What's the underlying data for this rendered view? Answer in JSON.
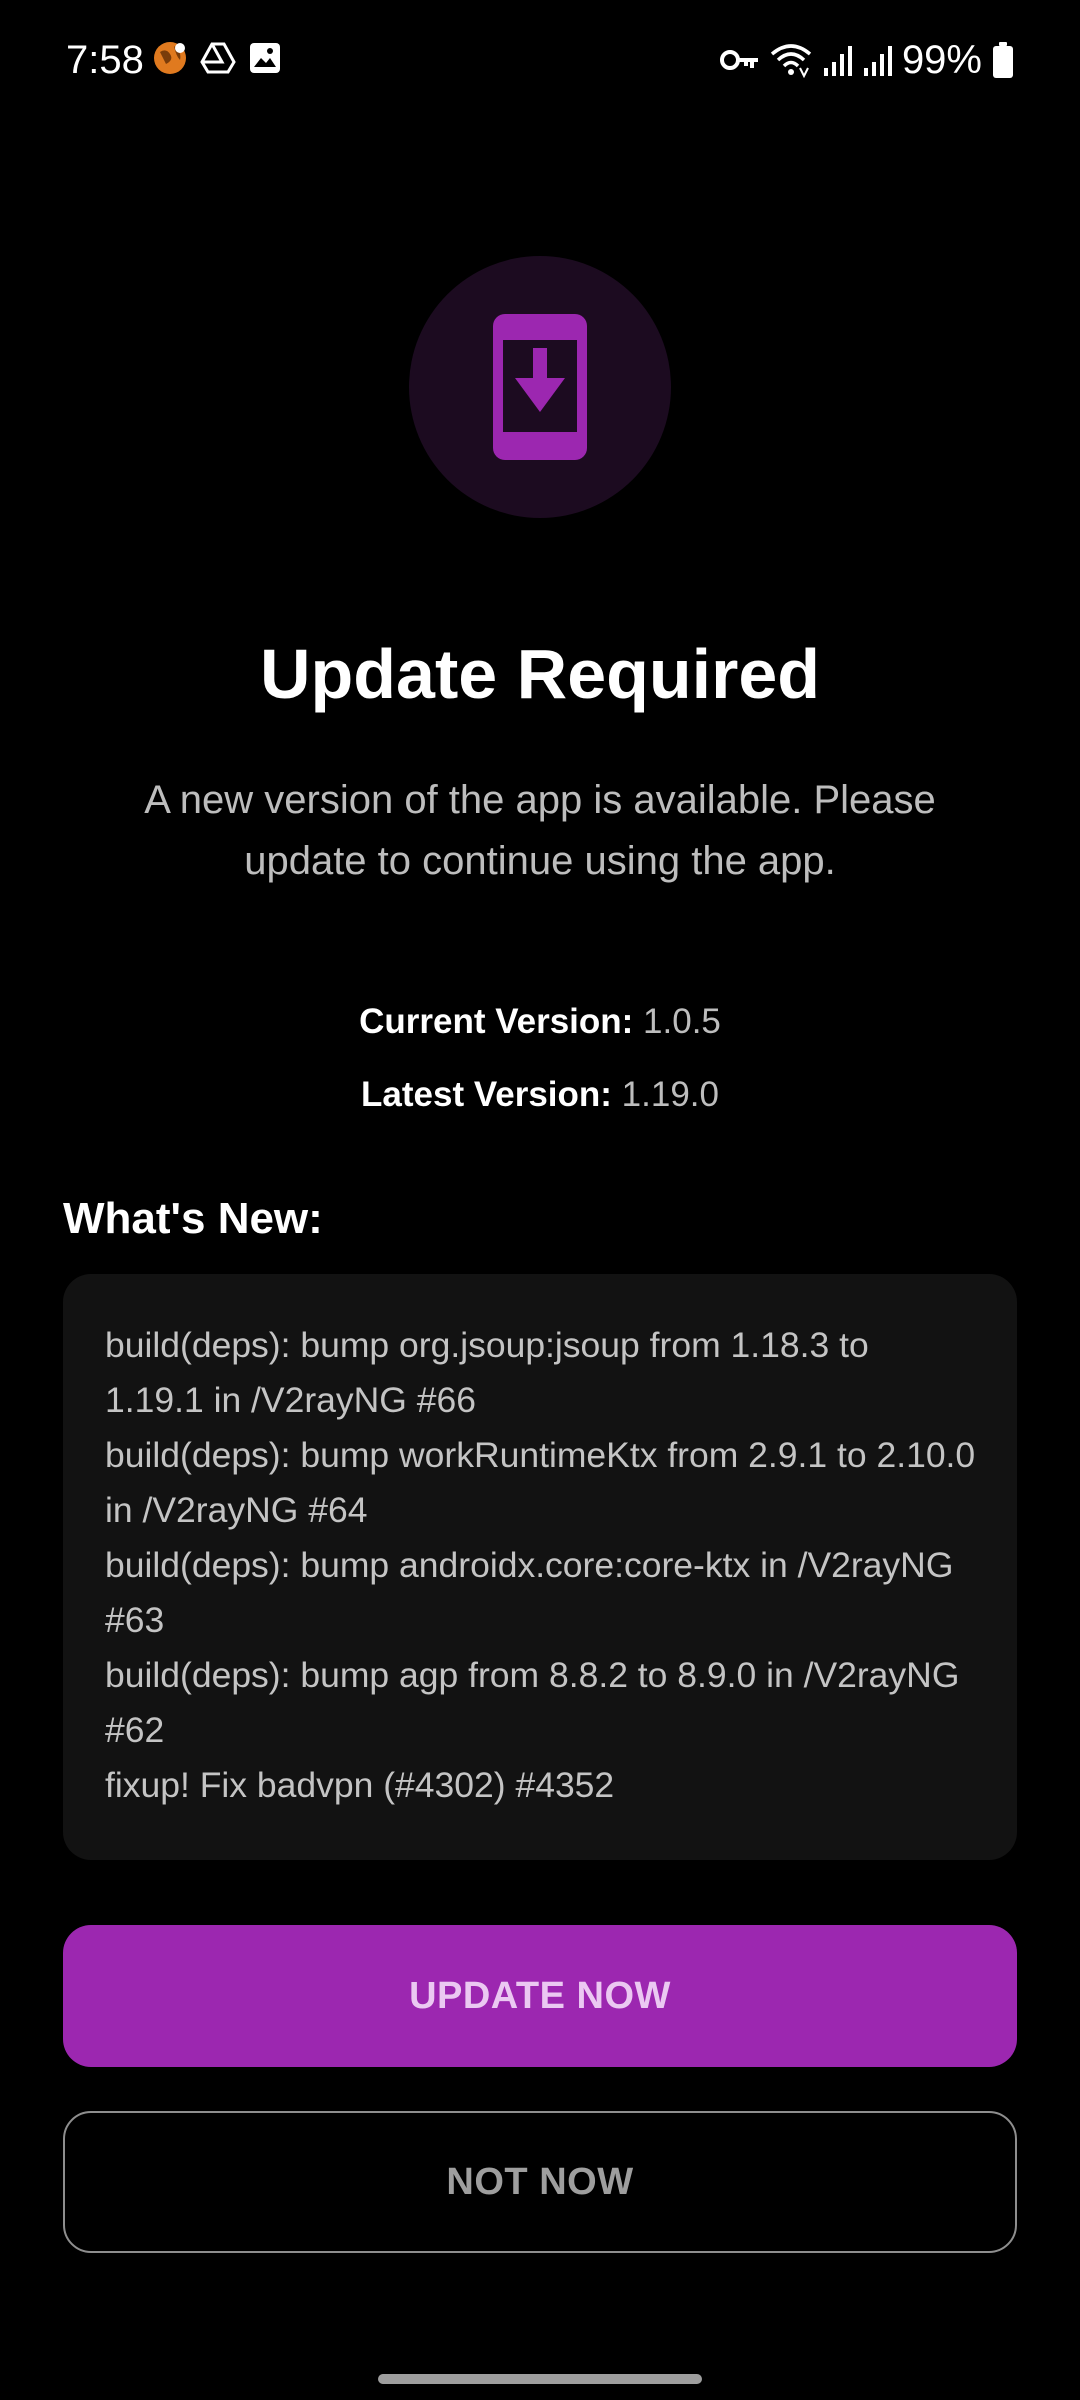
{
  "status_bar": {
    "time": "7:58",
    "battery_percent": "99%",
    "left_icons": [
      "vpn-globe-icon",
      "drive-icon",
      "gallery-icon"
    ],
    "right_icons": [
      "vpn-key-icon",
      "wifi-icon",
      "signal-icon",
      "signal-icon",
      "battery-icon"
    ],
    "notification_accent": "#e07a1f"
  },
  "hero": {
    "icon": "phone-download-icon",
    "accent_color": "#9c27b0",
    "circle_color": "#1c0b20"
  },
  "dialog": {
    "title": "Update Required",
    "message": "A new version of the app is available. Please update to continue using the app.",
    "current_version_label": "Current Version:",
    "current_version_value": "1.0.5",
    "latest_version_label": "Latest Version:",
    "latest_version_value": "1.19.0",
    "whats_new_heading": "What's New:",
    "changelog": [
      "build(deps): bump org.jsoup:jsoup from 1.18.3 to 1.19.1 in /V2rayNG #66",
      "build(deps): bump workRuntimeKtx from 2.9.1 to 2.10.0 in /V2rayNG #64",
      "build(deps): bump androidx.core:core-ktx in /V2rayNG #63",
      "build(deps): bump agp from 8.8.2 to 8.9.0 in /V2rayNG #62",
      "fixup! Fix badvpn (#4302) #4352"
    ]
  },
  "buttons": {
    "update_now": "UPDATE NOW",
    "not_now": "NOT NOW"
  }
}
